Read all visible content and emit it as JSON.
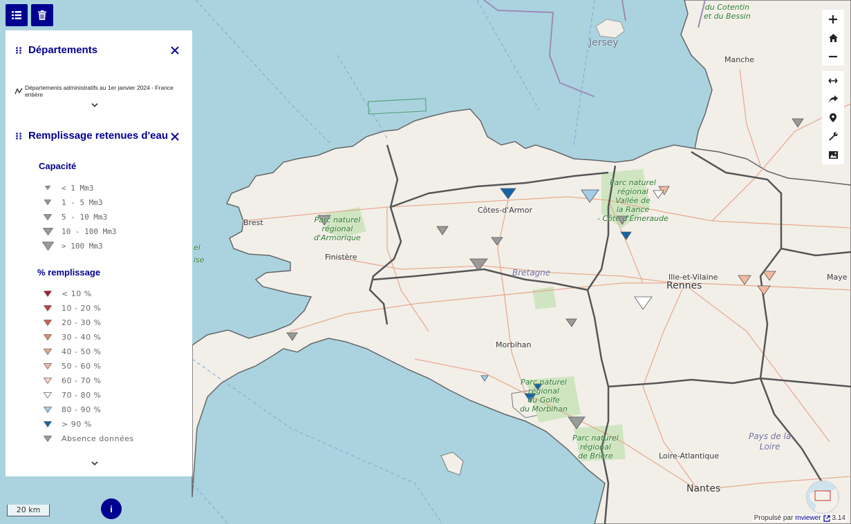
{
  "map_labels": {
    "jersey": "Jersey",
    "cotentin": "du Cotentin\net du Bessin",
    "manche": "Manche",
    "cotes_armor": "Côtes-d'Armor",
    "brest": "Brest",
    "finistere": "Finistère",
    "bretagne": "Bretagne",
    "morbihan": "Morbihan",
    "ille_vilaine": "Ille-et-Vilaine",
    "rennes": "Rennes",
    "mayenne": "Maye",
    "loire_atlantique": "Loire-Atlantique",
    "nantes": "Nantes",
    "pays_loire": "Pays de la\nLoire",
    "parc_armorique": "Parc naturel\nrégional\nd'Armorique",
    "parc_rance": "Parc naturel\nrégional\nVallée de\nla Rance\n- Côte d'Émeraude",
    "parc_golfe": "Parc naturel\nrégional\ndu Golfe\ndu Morbihan",
    "parc_briere": "Parc naturel\nrégional\nde Brière",
    "parc_marin_a": "el",
    "parc_marin_b": "ise"
  },
  "panel": {
    "layer1": {
      "title": "Départements",
      "subtitle": "Départements administratifs au 1er janvier 2024 - France entière"
    },
    "layer2": {
      "title": "Remplissage retenues d'eau",
      "capacity_title": "Capacité",
      "capacity_items": [
        "< 1 Mm3",
        "1 - 5 Mm3",
        "5 - 10 Mm3",
        "10 - 100 Mm3",
        "> 100 Mm3"
      ],
      "fill_title": "% remplissage",
      "fill_items": [
        "< 10 %",
        "10 - 20 %",
        "20 - 30 %",
        "30 - 40 %",
        "40 - 50 %",
        "50 - 60 %",
        "60 - 70 %",
        "70 - 80 %",
        "80 - 90 %",
        "> 90 %",
        "Absence données"
      ],
      "fill_colors": [
        "#b2182b",
        "#c93a3f",
        "#d6604d",
        "#e38a6c",
        "#f0a582",
        "#f4b9a0",
        "#fbd6c4",
        "#ffffff",
        "#a6cde6",
        "#1465a8",
        "#9a9a9a"
      ]
    }
  },
  "scale_label": "20 km",
  "info_label": "i",
  "attribution": {
    "prefix": "Propulsé par",
    "link": "mviewer",
    "version": "3.14"
  },
  "colors": {
    "primary": "#000091",
    "sea": "#aad3df",
    "land": "#f2efe9",
    "border": "#555555"
  }
}
